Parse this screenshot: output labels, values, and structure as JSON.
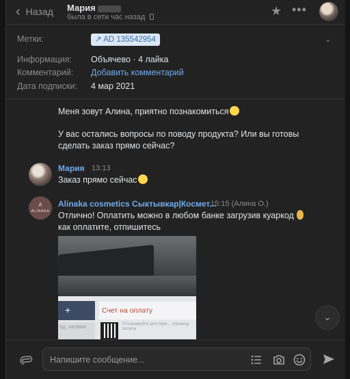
{
  "header": {
    "back_label": "Назад",
    "contact_name": "Мария",
    "status": "была в сети час назад"
  },
  "info": {
    "labels_key": "Метки:",
    "tag": "AD 135542954",
    "information_key": "Информация:",
    "information_value": "Объячево · 4 лайка",
    "comment_key": "Комментарий:",
    "comment_value": "Добавить комментарий",
    "subscribed_key": "Дата подписки:",
    "subscribed_value": "4 мар 2021"
  },
  "messages": [
    {
      "text": "Меня зовут Алина, приятно познакомиться"
    },
    {
      "text": "У вас остались вопросы по поводу продукта? Или вы готовы сделать заказ прямо сейчас?"
    },
    {
      "sender": "Мария",
      "time": "13:13",
      "text": "Заказ прямо сейчас"
    },
    {
      "sender": "Alinaka cosmetics Сыктывкар|Космет...",
      "time": "15:15 (Алина О.)",
      "text": "Отлично! Оплатить можно в любом банке загрузив куаркод",
      "text2": "как оплатите, отпишитесь",
      "avatar_mono": "A",
      "avatar_brand": "ALINAKA"
    }
  ],
  "photo": {
    "plus": "+",
    "bill_label": "Счет на оплату",
    "small_text": "Отсканируйте для пере... страницу оплаты",
    "side_text": "од. назван"
  },
  "composer": {
    "placeholder": "Напишите сообщение..."
  }
}
